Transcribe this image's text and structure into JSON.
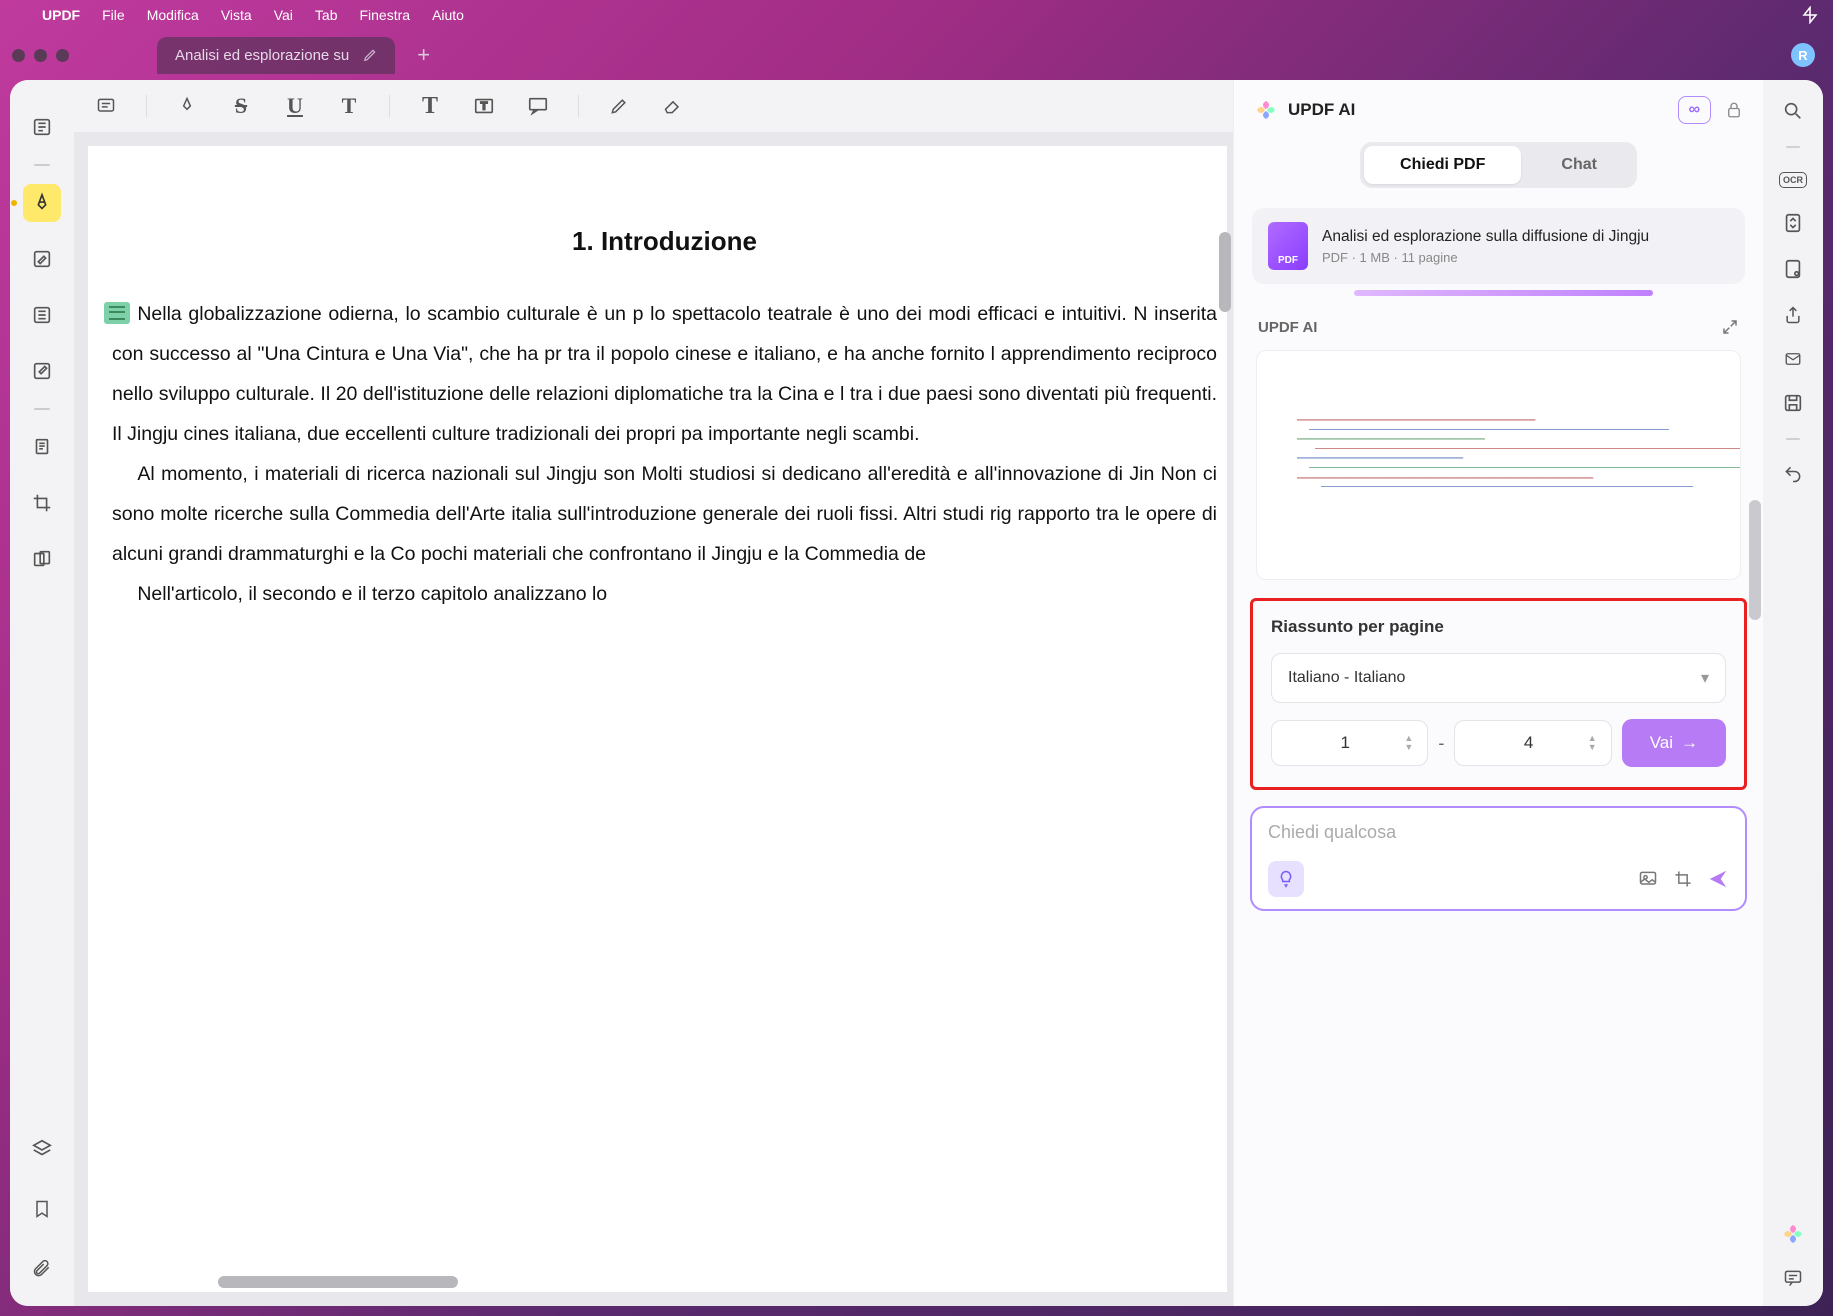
{
  "menubar": {
    "app": "UPDF",
    "items": [
      "File",
      "Modifica",
      "Vista",
      "Vai",
      "Tab",
      "Finestra",
      "Aiuto"
    ]
  },
  "tab": {
    "title": "Analisi ed esplorazione su"
  },
  "avatar_letter": "R",
  "ai": {
    "title": "UPDF AI",
    "infinity": "∞",
    "tabs": {
      "ask": "Chiedi PDF",
      "chat": "Chat"
    },
    "doc": {
      "name": "Analisi ed esplorazione sulla diffusione di Jingju",
      "meta": "PDF · 1 MB · 11 pagine"
    },
    "section_label": "UPDF AI",
    "summary": {
      "heading": "Riassunto per pagine",
      "language": "Italiano - Italiano",
      "from": "1",
      "to": "4",
      "go": "Vai"
    },
    "ask_placeholder": "Chiedi qualcosa"
  },
  "document": {
    "heading": "1. Introduzione",
    "para1": "Nella globalizzazione odierna, lo scambio culturale è un p lo spettacolo teatrale è uno dei modi efficaci e intuitivi. N inserita con successo al \"Una Cintura e Una Via\", che ha pr tra il popolo cinese e italiano, e ha anche fornito l apprendimento reciproco nello sviluppo culturale. Il 20 dell'istituzione delle relazioni diplomatiche tra la Cina e l tra i due paesi sono diventati più frequenti. Il Jingju cines italiana, due eccellenti culture tradizionali dei propri pa importante negli scambi.",
    "para2": "Al momento, i materiali di ricerca nazionali sul Jingju son Molti studiosi si dedicano all'eredità e all'innovazione di Jin Non ci sono molte ricerche sulla Commedia dell'Arte italia sull'introduzione generale dei ruoli fissi. Altri studi rig rapporto tra le opere di alcuni grandi drammaturghi e la Co pochi materiali che confrontano il Jingju e la Commedia de",
    "para3": "Nell'articolo, il secondo e il terzo capitolo analizzano lo"
  },
  "right_rail": {
    "ocr": "OCR"
  }
}
